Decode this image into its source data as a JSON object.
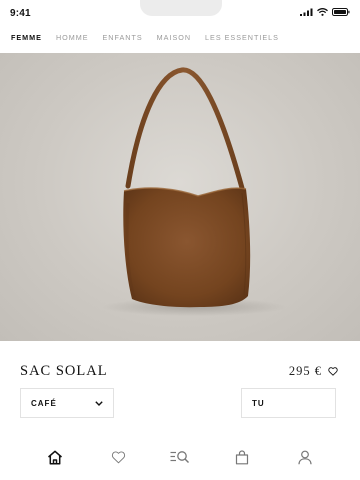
{
  "status_bar": {
    "time": "9:41"
  },
  "nav": {
    "items": [
      {
        "label": "FEMME",
        "active": true
      },
      {
        "label": "HOMME",
        "active": false
      },
      {
        "label": "ENFANTS",
        "active": false
      },
      {
        "label": "MAISON",
        "active": false
      },
      {
        "label": "LES ESSENTIELS",
        "active": false
      }
    ]
  },
  "product": {
    "title": "SAC SOLAL",
    "price": "295 €",
    "color_select": {
      "value": "CAFÉ"
    },
    "size_select": {
      "value": "TU"
    }
  },
  "tab_bar": {
    "icons": [
      "home-icon",
      "heart-icon",
      "search-icon",
      "bag-icon",
      "user-icon"
    ]
  },
  "colors": {
    "accent": "#111111",
    "bag": "#7a4a26",
    "hero_bg": "#cdc9c3"
  }
}
